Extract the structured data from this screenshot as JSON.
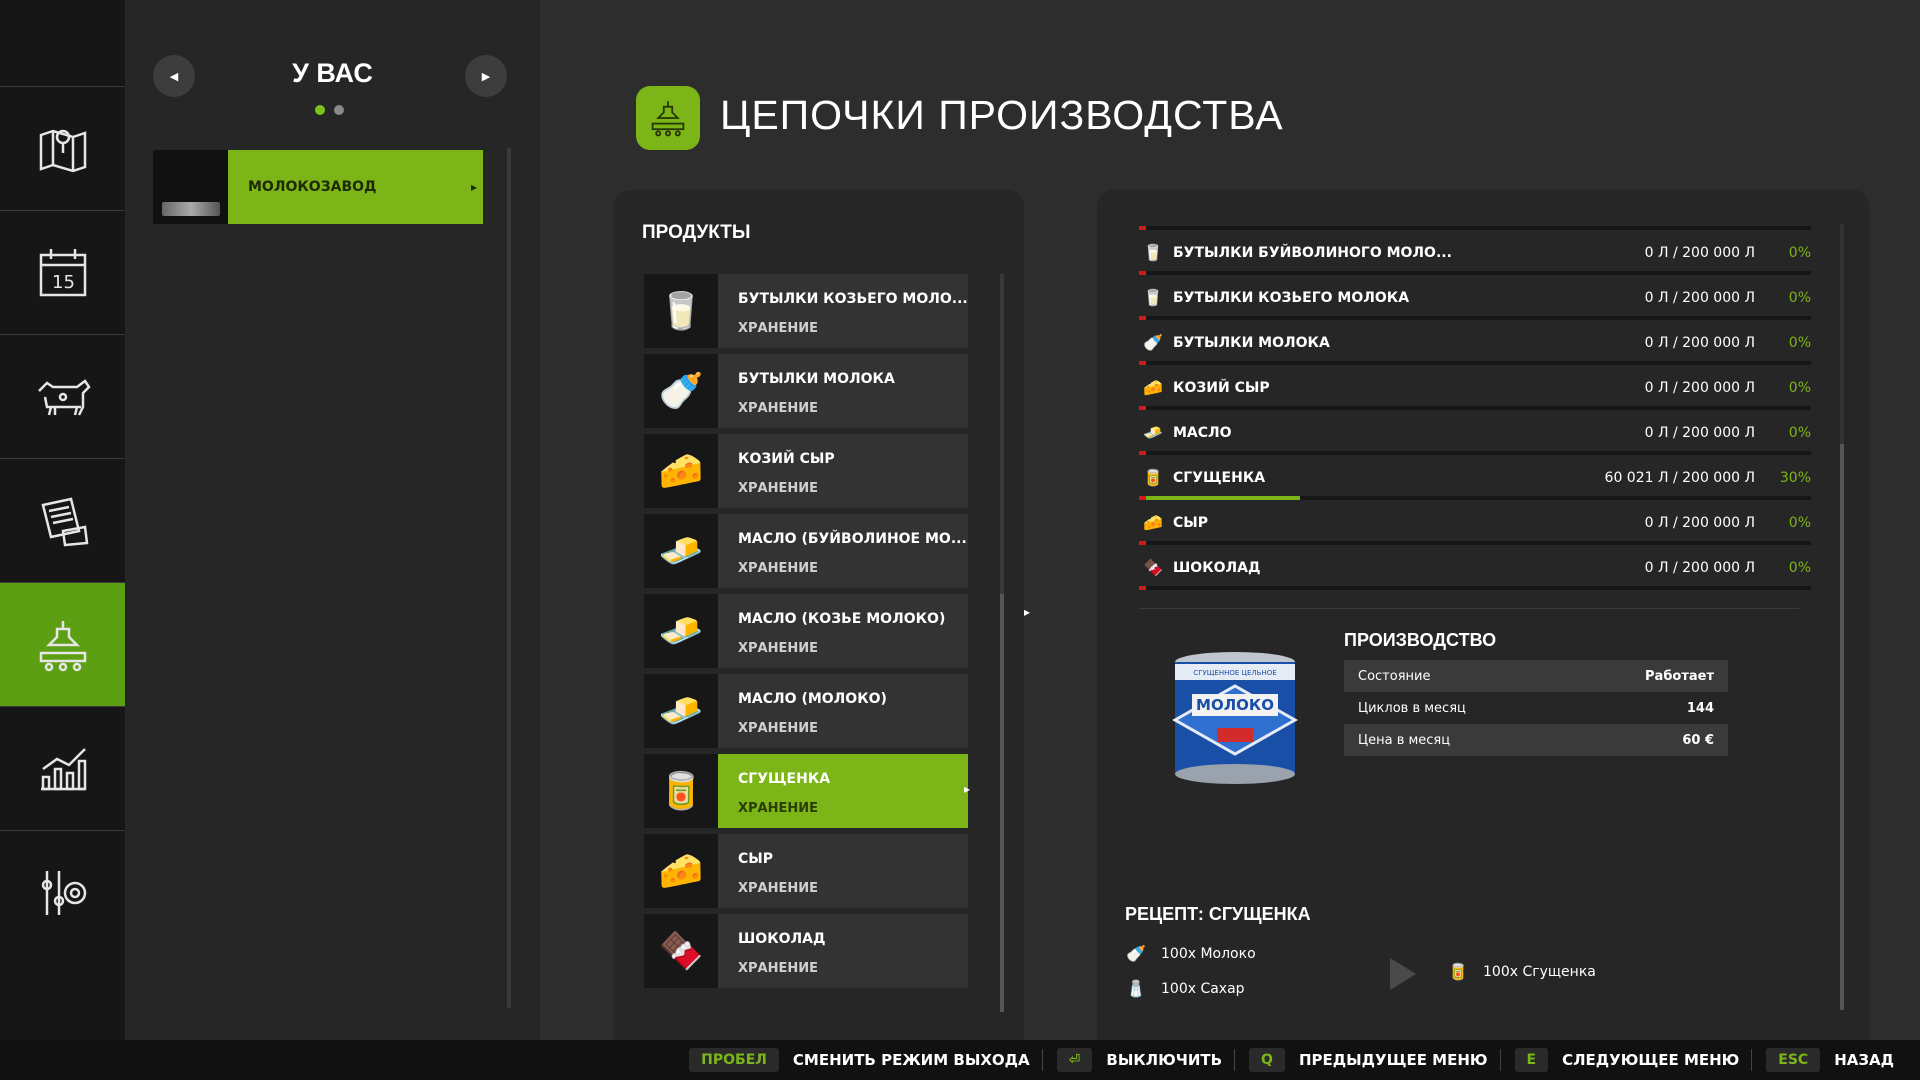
{
  "sidebar": {
    "items": [
      {
        "icon": "map-icon",
        "active": false
      },
      {
        "icon": "calendar-icon",
        "active": false,
        "day": "15"
      },
      {
        "icon": "cow-icon",
        "active": false
      },
      {
        "icon": "contracts-icon",
        "active": false
      },
      {
        "icon": "production-icon",
        "active": true
      },
      {
        "icon": "statistics-icon",
        "active": false
      },
      {
        "icon": "settings-icon",
        "active": false
      }
    ]
  },
  "owner_panel": {
    "title": "У ВАС",
    "page_dots": 2,
    "current_page": 1,
    "factory": {
      "label": "МОЛОКОЗАВОД"
    }
  },
  "header": {
    "title": "ЦЕПОЧКИ ПРОИЗВОДСТВА",
    "icon": "production-chain-icon"
  },
  "products": {
    "title": "ПРОДУКТЫ",
    "items": [
      {
        "name": "БУТЫЛКИ КОЗЬЕГО МОЛО...",
        "sub": "ХРАНЕНИЕ",
        "icon": "🥛"
      },
      {
        "name": "БУТЫЛКИ МОЛОКА",
        "sub": "ХРАНЕНИЕ",
        "icon": "🍼"
      },
      {
        "name": "КОЗИЙ СЫР",
        "sub": "ХРАНЕНИЕ",
        "icon": "🧀"
      },
      {
        "name": "МАСЛО (БУЙВОЛИНОЕ МО...",
        "sub": "ХРАНЕНИЕ",
        "icon": "🧈"
      },
      {
        "name": "МАСЛО (КОЗЬЕ МОЛОКО)",
        "sub": "ХРАНЕНИЕ",
        "icon": "🧈"
      },
      {
        "name": "МАСЛО (МОЛОКО)",
        "sub": "ХРАНЕНИЕ",
        "icon": "🧈"
      },
      {
        "name": "СГУЩЕНКА",
        "sub": "ХРАНЕНИЕ",
        "icon": "🥫",
        "active": true
      },
      {
        "name": "СЫР",
        "sub": "ХРАНЕНИЕ",
        "icon": "🧀"
      },
      {
        "name": "ШОКОЛАД",
        "sub": "ХРАНЕНИЕ",
        "icon": "🍫"
      }
    ]
  },
  "storage": {
    "rows": [
      {
        "name": "БУТЫЛКИ БУЙВОЛИНОГО МОЛО...",
        "value": "0 Л / 200 000 Л",
        "percent": "0%",
        "fill": 0,
        "icon": "🥛"
      },
      {
        "name": "БУТЫЛКИ КОЗЬЕГО МОЛОКА",
        "value": "0 Л / 200 000 Л",
        "percent": "0%",
        "fill": 0,
        "icon": "🥛"
      },
      {
        "name": "БУТЫЛКИ МОЛОКА",
        "value": "0 Л / 200 000 Л",
        "percent": "0%",
        "fill": 0,
        "icon": "🍼"
      },
      {
        "name": "КОЗИЙ СЫР",
        "value": "0 Л / 200 000 Л",
        "percent": "0%",
        "fill": 0,
        "icon": "🧀"
      },
      {
        "name": "МАСЛО",
        "value": "0 Л / 200 000 Л",
        "percent": "0%",
        "fill": 0,
        "icon": "🧈"
      },
      {
        "name": "СГУЩЕНКА",
        "value": "60 021 Л / 200 000 Л",
        "percent": "30%",
        "fill": 0.3,
        "icon": "🥫"
      },
      {
        "name": "СЫР",
        "value": "0 Л / 200 000 Л",
        "percent": "0%",
        "fill": 0,
        "icon": "🧀"
      },
      {
        "name": "ШОКОЛАД",
        "value": "0 Л / 200 000 Л",
        "percent": "0%",
        "fill": 0,
        "icon": "🍫"
      }
    ]
  },
  "production": {
    "title": "ПРОИЗВОДСТВО",
    "can_brand": "МОЛОКО",
    "can_label_top": "СГУЩЕННОЕ ЦЕЛЬНОЕ",
    "rows": [
      {
        "label": "Состояние",
        "value": "Работает"
      },
      {
        "label": "Циклов в месяц",
        "value": "144"
      },
      {
        "label": "Цена в месяц",
        "value": "60 €"
      }
    ]
  },
  "recipe": {
    "title": "РЕЦЕПТ: СГУЩЕНКА",
    "inputs": [
      {
        "text": "100x Молоко",
        "icon": "🍼"
      },
      {
        "text": "100x Сахар",
        "icon": "🧂"
      }
    ],
    "output": {
      "text": "100x Сгущенка",
      "icon": "🥫"
    }
  },
  "footer": {
    "actions": [
      {
        "key": "ПРОБЕЛ",
        "label": "СМЕНИТЬ РЕЖИМ ВЫХОДА"
      },
      {
        "key": "⏎",
        "label": "ВЫКЛЮЧИТЬ"
      },
      {
        "key": "Q",
        "label": "ПРЕДЫДУЩЕЕ МЕНЮ"
      },
      {
        "key": "E",
        "label": "СЛЕДУЮЩЕЕ МЕНЮ"
      },
      {
        "key": "ESC",
        "label": "НАЗАД"
      }
    ]
  },
  "colors": {
    "accent": "#7cb518",
    "rail_active": "#5d9f12",
    "warning": "#d01b1b"
  }
}
